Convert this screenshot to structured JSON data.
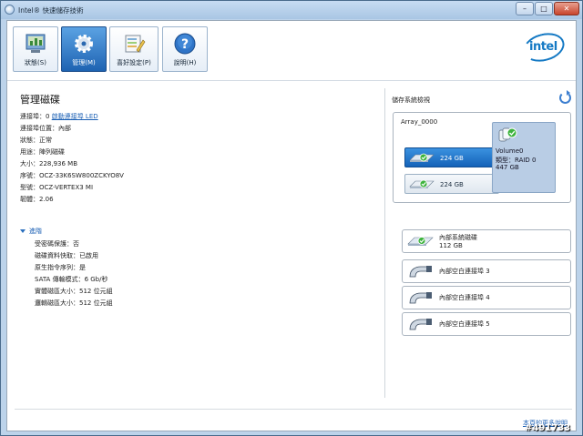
{
  "window": {
    "title": "Intel® 快速儲存技術",
    "buttons": {
      "minimize": "–",
      "maximize": "□",
      "close": "✕"
    }
  },
  "toolbar": {
    "items": [
      {
        "label": "狀態(S)",
        "icon": "status-icon"
      },
      {
        "label": "管理(M)",
        "icon": "gear-icon",
        "active": true
      },
      {
        "label": "喜好設定(P)",
        "icon": "preferences-icon"
      },
      {
        "label": "說明(H)",
        "icon": "help-icon"
      }
    ]
  },
  "logo": {
    "text": "intel"
  },
  "details": {
    "title": "管理磁碟",
    "port_label": "連接埠：0",
    "led_link": "啟動連接埠 LED",
    "props": [
      "連接埠位置：內部",
      "狀態：正常",
      "用途：陣列磁碟",
      "大小：228,936 MB",
      "序號：OCZ-33K6SW800ZCKYO8V",
      "型號：OCZ-VERTEX3 MI",
      "韌體：2.06"
    ],
    "advanced_label": "進階",
    "advanced": [
      "受密碼保護：否",
      "磁碟資料快取：已啟用",
      "原生指令序列：是",
      "SATA 傳輸模式：6 Gb/秒",
      "實體磁區大小：512 位元組",
      "邏輯磁區大小：512 位元組"
    ]
  },
  "storage": {
    "title": "儲存系統檢視",
    "array": {
      "name": "Array_0000",
      "disks": [
        "224 GB",
        "224 GB"
      ],
      "volume": {
        "name": "Volume0",
        "type": "類型：RAID 0",
        "size": "447 GB"
      }
    },
    "items": [
      {
        "line1": "內部系統磁碟",
        "line2": "112 GB"
      },
      {
        "line1": "內部空白連接埠 3",
        "line2": ""
      },
      {
        "line1": "內部空白連接埠 4",
        "line2": ""
      },
      {
        "line1": "內部空白連接埠 5",
        "line2": ""
      }
    ]
  },
  "footer": {
    "more_help": "本頁的更多說明"
  },
  "watermark": "#491733",
  "colors": {
    "accent": "#1e63b2",
    "link": "#1a5fb4",
    "ok": "#3db33d"
  }
}
